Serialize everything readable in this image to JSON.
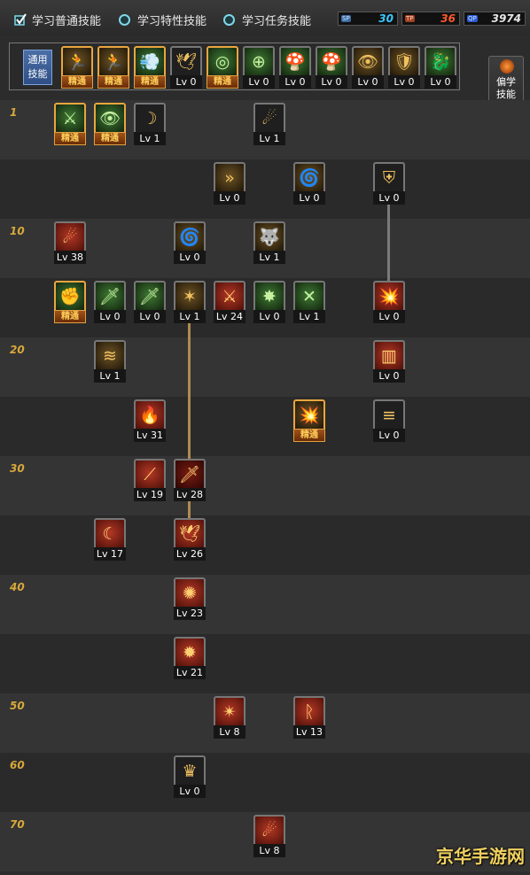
{
  "tabs": [
    {
      "label": "学习普通技能",
      "icon": "check-icon",
      "selected": true
    },
    {
      "label": "学习特性技能",
      "icon": "radio-icon",
      "selected": false
    },
    {
      "label": "学习任务技能",
      "icon": "radio-icon",
      "selected": false
    }
  ],
  "points": [
    {
      "label": "SP",
      "value": "30",
      "color": "#3ac8ff"
    },
    {
      "label": "TP",
      "value": "36",
      "color": "#ff5a2a"
    },
    {
      "label": "QP",
      "value": "3974",
      "color": "#e6e6e6"
    }
  ],
  "common": {
    "label_line1": "通用",
    "label_line2": "技能"
  },
  "skill_button": {
    "line1": "偏学",
    "line2": "技能",
    "icon": "flame-icon"
  },
  "level_labels": [
    "1",
    "10",
    "20",
    "30",
    "40",
    "50",
    "60",
    "70"
  ],
  "mastered_label": "精通",
  "common_skills": [
    {
      "icon": "figure-icon",
      "color": "gold",
      "level": "精通",
      "mastered": true
    },
    {
      "icon": "runner-icon",
      "color": "gold",
      "level": "精通",
      "mastered": true
    },
    {
      "icon": "dash-icon",
      "color": "green",
      "level": "精通",
      "mastered": true
    },
    {
      "icon": "wings-icon",
      "color": "dark",
      "level": "Lv 0",
      "mastered": false
    },
    {
      "icon": "target-icon",
      "color": "green",
      "level": "精通",
      "mastered": true
    },
    {
      "icon": "crosshair-icon",
      "color": "green",
      "level": "Lv 0",
      "mastered": false
    },
    {
      "icon": "mushroom-icon",
      "color": "green",
      "level": "Lv 0",
      "mastered": false
    },
    {
      "icon": "mushroom-icon",
      "color": "green",
      "level": "Lv 0",
      "mastered": false
    },
    {
      "icon": "eye-icon",
      "color": "gold",
      "level": "Lv 0",
      "mastered": false
    },
    {
      "icon": "titan-icon",
      "color": "gold",
      "level": "Lv 0",
      "mastered": false
    },
    {
      "icon": "dragon-icon",
      "color": "green",
      "level": "Lv 0",
      "mastered": false
    }
  ],
  "tree_rows": [
    {
      "label": "1",
      "skills": [
        {
          "icon": "slash-icon",
          "color": "green",
          "level": "精通",
          "mastered": true
        },
        {
          "icon": "eye-icon",
          "color": "green",
          "level": "精通",
          "mastered": true
        },
        {
          "icon": "arc-icon",
          "color": "dark",
          "level": "Lv 1",
          "mastered": false
        },
        {
          "icon": "claw-icon",
          "color": "dark",
          "level": "Lv 1",
          "mastered": false
        }
      ]
    },
    {
      "label": "",
      "skills": [
        {
          "icon": "chevrons-icon",
          "color": "gold",
          "level": "Lv 0",
          "mastered": false
        },
        {
          "icon": "spin-icon",
          "color": "gold",
          "level": "Lv 0",
          "mastered": false
        },
        {
          "icon": "shield-icon",
          "color": "dark",
          "level": "Lv 0",
          "mastered": false
        }
      ]
    },
    {
      "label": "10",
      "skills": [
        {
          "icon": "wave-icon",
          "color": "red",
          "level": "Lv 38",
          "mastered": false
        },
        {
          "icon": "vortex-icon",
          "color": "gold",
          "level": "Lv 0",
          "mastered": false
        },
        {
          "icon": "beast-icon",
          "color": "gold",
          "level": "Lv 1",
          "mastered": false
        }
      ]
    },
    {
      "label": "",
      "skills": [
        {
          "icon": "fist-icon",
          "color": "green",
          "level": "精通",
          "mastered": true
        },
        {
          "icon": "sword-icon",
          "color": "green",
          "level": "Lv 0",
          "mastered": false
        },
        {
          "icon": "sword-icon",
          "color": "green",
          "level": "Lv 0",
          "mastered": false
        },
        {
          "icon": "strike-icon",
          "color": "gold",
          "level": "Lv 1",
          "mastered": false
        },
        {
          "icon": "blade-icon",
          "color": "red",
          "level": "Lv 24",
          "mastered": false
        },
        {
          "icon": "burst-icon",
          "color": "green",
          "level": "Lv 0",
          "mastered": false
        },
        {
          "icon": "cross-slash-icon",
          "color": "green",
          "level": "Lv 1",
          "mastered": false
        },
        {
          "icon": "cannon-icon",
          "color": "red",
          "level": "Lv 0",
          "mastered": false
        }
      ]
    },
    {
      "label": "20",
      "skills": [
        {
          "icon": "swirl-icon",
          "color": "gold",
          "level": "Lv 1",
          "mastered": false
        },
        {
          "icon": "pillar-icon",
          "color": "red",
          "level": "Lv 0",
          "mastered": false
        }
      ]
    },
    {
      "label": "",
      "skills": [
        {
          "icon": "flame-icon",
          "color": "red",
          "level": "Lv 31",
          "mastered": false
        },
        {
          "icon": "explosion-icon",
          "color": "gold",
          "level": "精通",
          "mastered": true
        },
        {
          "icon": "streak-icon",
          "color": "dark",
          "level": "Lv 0",
          "mastered": false
        }
      ]
    },
    {
      "label": "30",
      "skills": [
        {
          "icon": "slash-red-icon",
          "color": "red",
          "level": "Lv 19",
          "mastered": false
        },
        {
          "icon": "dagger-icon",
          "color": "darkred",
          "level": "Lv 28",
          "mastered": false
        }
      ]
    },
    {
      "label": "",
      "skills": [
        {
          "icon": "moon-icon",
          "color": "red",
          "level": "Lv 17",
          "mastered": false
        },
        {
          "icon": "phoenix-icon",
          "color": "red",
          "level": "Lv 26",
          "mastered": false
        }
      ]
    },
    {
      "label": "40",
      "skills": [
        {
          "icon": "sunburst-icon",
          "color": "red",
          "level": "Lv 23",
          "mastered": false
        }
      ]
    },
    {
      "label": "",
      "skills": [
        {
          "icon": "blast-icon",
          "color": "red",
          "level": "Lv 21",
          "mastered": false
        }
      ]
    },
    {
      "label": "50",
      "skills": [
        {
          "icon": "shatter-icon",
          "color": "red",
          "level": "Lv 8",
          "mastered": false
        },
        {
          "icon": "rune-icon",
          "color": "red",
          "level": "Lv 13",
          "mastered": false
        }
      ]
    },
    {
      "label": "60",
      "skills": [
        {
          "icon": "crown-icon",
          "color": "dark",
          "level": "Lv 0",
          "mastered": false
        }
      ]
    },
    {
      "label": "70",
      "skills": [
        {
          "icon": "comet-icon",
          "color": "red",
          "level": "Lv 8",
          "mastered": false
        }
      ]
    }
  ],
  "watermark": "京华手游网"
}
